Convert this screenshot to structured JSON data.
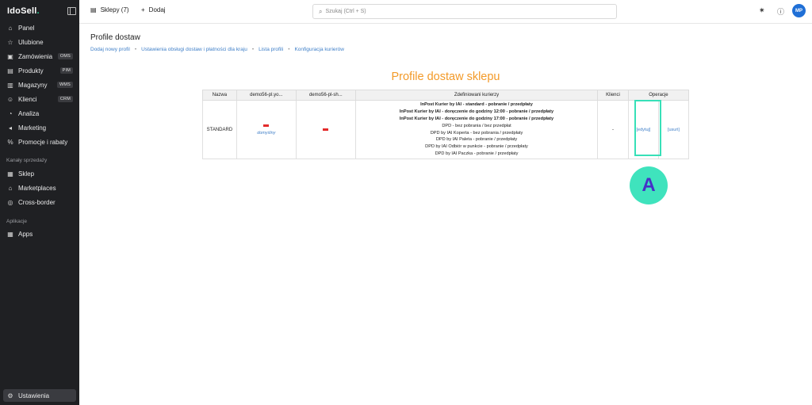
{
  "brand": {
    "logo_main": "IdoSell",
    "logo_dot": "."
  },
  "sidebar": {
    "items": [
      {
        "label": "Panel",
        "icon": "house-icon"
      },
      {
        "label": "Ulubione",
        "icon": "star-icon"
      },
      {
        "label": "Zamówienia",
        "icon": "orders-icon",
        "badge": "OMS"
      },
      {
        "label": "Produkty",
        "icon": "box-icon",
        "badge": "PIM"
      },
      {
        "label": "Magazyny",
        "icon": "warehouse-icon",
        "badge": "WMS"
      },
      {
        "label": "Klienci",
        "icon": "users-icon",
        "badge": "CRM"
      },
      {
        "label": "Analiza",
        "icon": "chart-icon"
      },
      {
        "label": "Marketing",
        "icon": "megaphone-icon"
      },
      {
        "label": "Promocje i rabaty",
        "icon": "percent-icon"
      }
    ],
    "section_sales": "Kanały sprzedaży",
    "sales_items": [
      {
        "label": "Sklep",
        "icon": "shop-icon"
      },
      {
        "label": "Marketplaces",
        "icon": "marketplace-icon"
      },
      {
        "label": "Cross-border",
        "icon": "globe-icon"
      }
    ],
    "section_apps": "Aplikacje",
    "apps_items": [
      {
        "label": "Apps",
        "icon": "apps-icon"
      }
    ],
    "settings_label": "Ustawienia"
  },
  "topbar": {
    "shops_label": "Sklepy (7)",
    "add_label": "Dodaj",
    "search_placeholder": "Szukaj (Ctrl + S)",
    "avatar": "MP"
  },
  "page": {
    "title": "Profile dostaw",
    "breadcrumbs": [
      "Dodaj nowy profil",
      "Ustawienia obsługi dostaw i płatności dla kraju",
      "Lista profili",
      "Konfiguracja kurierów"
    ],
    "heading": "Profile dostaw sklepu"
  },
  "table": {
    "headers": [
      "Nazwa",
      "demo56-pl.yo...",
      "demo56-pl-sh...",
      "Zdefiniowani kurierzy",
      "Klienci",
      "Operacje"
    ],
    "row": {
      "name": "STANDARD",
      "default_label": "domyślny",
      "couriers_bold": [
        "InPost Kurier by IAI - standard - pobranie / przedpłaty",
        "InPost Kurier by IAI - doręczenie do godziny 12:00 - pobranie / przedpłaty",
        "InPost Kurier by IAI - doręczenie do godziny 17:00 - pobranie / przedpłaty"
      ],
      "couriers": [
        "DPD - bez pobrania / bez przedpłat",
        "DPD by IAI Koperta - bez pobrania / przedpłaty",
        "DPD by IAI Paleta - pobranie / przedpłaty",
        "DPD by IAI Odbiór w punkcie - pobranie / przedpłaty",
        "DPD by IAI Paczka - pobranie / przedpłaty"
      ],
      "clients": "-",
      "edit_label": "[edytuj]",
      "delete_label": "[usuń]"
    }
  },
  "annotation": {
    "marker": "A",
    "color": "#3fe3bd"
  },
  "colors": {
    "accent_orange": "#f39a28",
    "link_blue": "#3f7fc8",
    "sidebar_bg": "#1f2023",
    "flag_red": "#e32b2b"
  }
}
